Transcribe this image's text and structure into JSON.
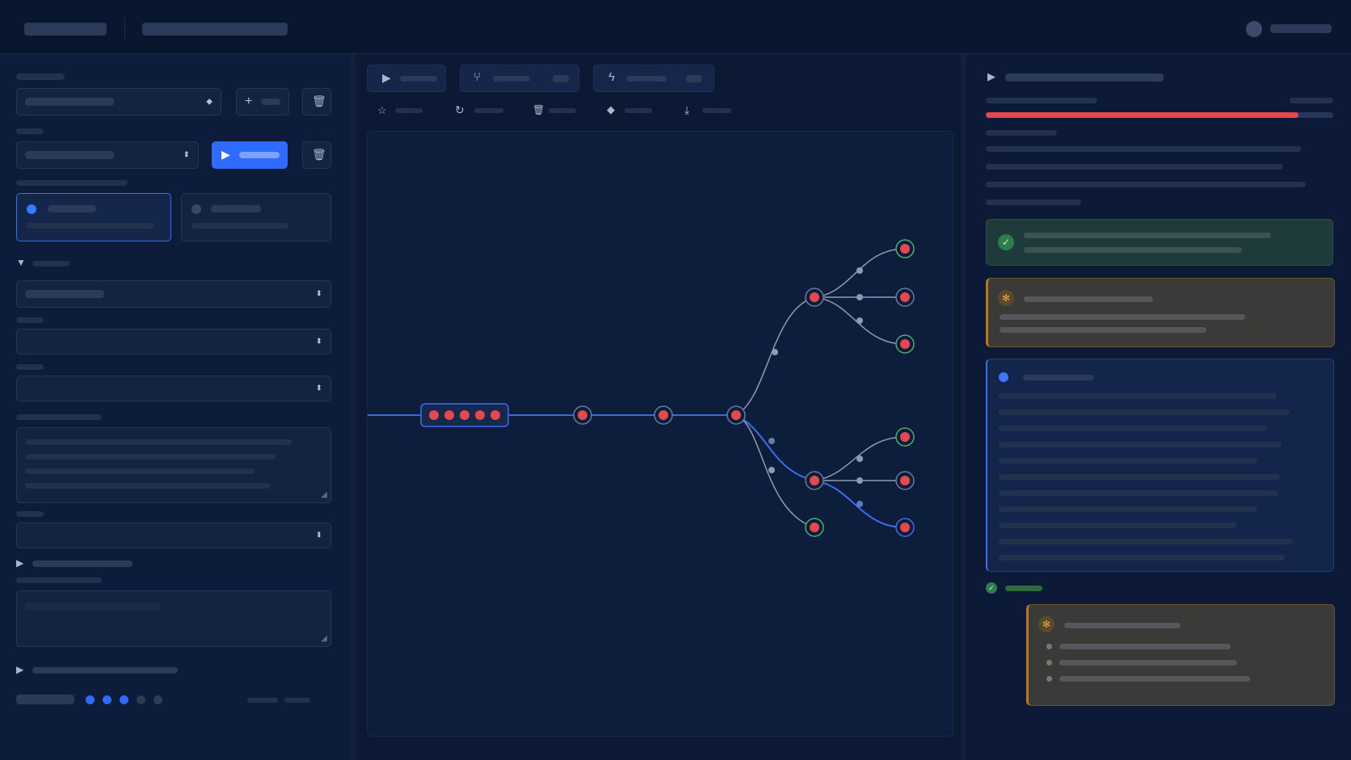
{
  "window": {
    "title": ""
  },
  "colors": {
    "accent": "#2f6bff",
    "error": "#e5484d",
    "success": "#2e7d4f",
    "warning": "#b7791f"
  },
  "left_panel": {
    "dataset_select": {
      "value": ""
    },
    "run_button": {
      "label": ""
    },
    "mode_options": [
      {
        "label": ""
      },
      {
        "label": ""
      }
    ],
    "pagination": {
      "total_dots": 5,
      "active_dots": 3
    }
  },
  "graph": {
    "chain_nodes": 5
  },
  "right_panel": {
    "progress": 0.9,
    "cards": [
      {
        "status": "success"
      },
      {
        "status": "warning"
      },
      {
        "status": "info"
      },
      {
        "status": "warning"
      }
    ]
  }
}
